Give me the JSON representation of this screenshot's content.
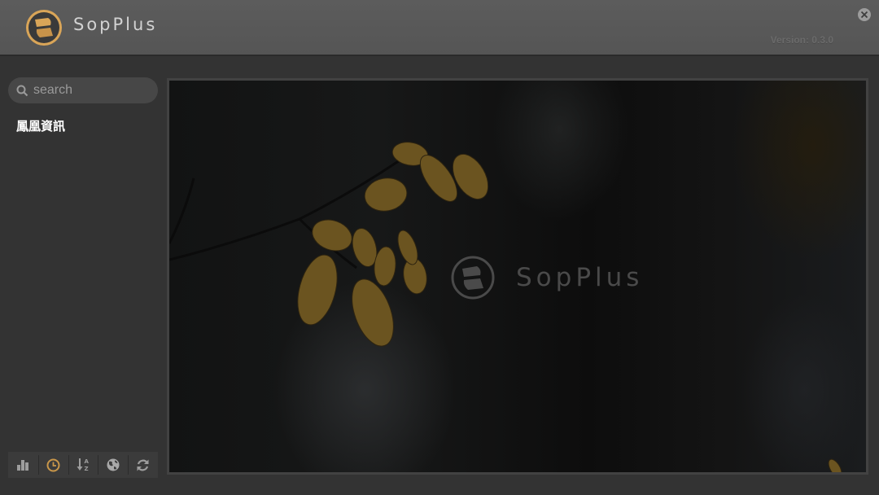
{
  "header": {
    "app_name": "SopPlus",
    "version": "Version: 0.3.0",
    "logo_icon": "sopplus-logo-icon",
    "close_icon": "close-icon"
  },
  "sidebar": {
    "search": {
      "placeholder": "search",
      "value": "",
      "icon": "search-icon"
    },
    "items": [
      {
        "label": "鳳凰資訊"
      }
    ],
    "toolbar": [
      {
        "name": "bar-chart",
        "icon": "bar-chart-icon",
        "active": false
      },
      {
        "name": "history",
        "icon": "clock-icon",
        "active": true
      },
      {
        "name": "sort-az",
        "icon": "sort-az-icon",
        "active": false
      },
      {
        "name": "globe",
        "icon": "globe-icon",
        "active": false
      },
      {
        "name": "refresh",
        "icon": "refresh-icon",
        "active": false
      }
    ]
  },
  "viewer": {
    "watermark": "SopPlus"
  },
  "colors": {
    "accent": "#c9974a",
    "header_bg": "#585858",
    "body_bg": "#333333"
  }
}
